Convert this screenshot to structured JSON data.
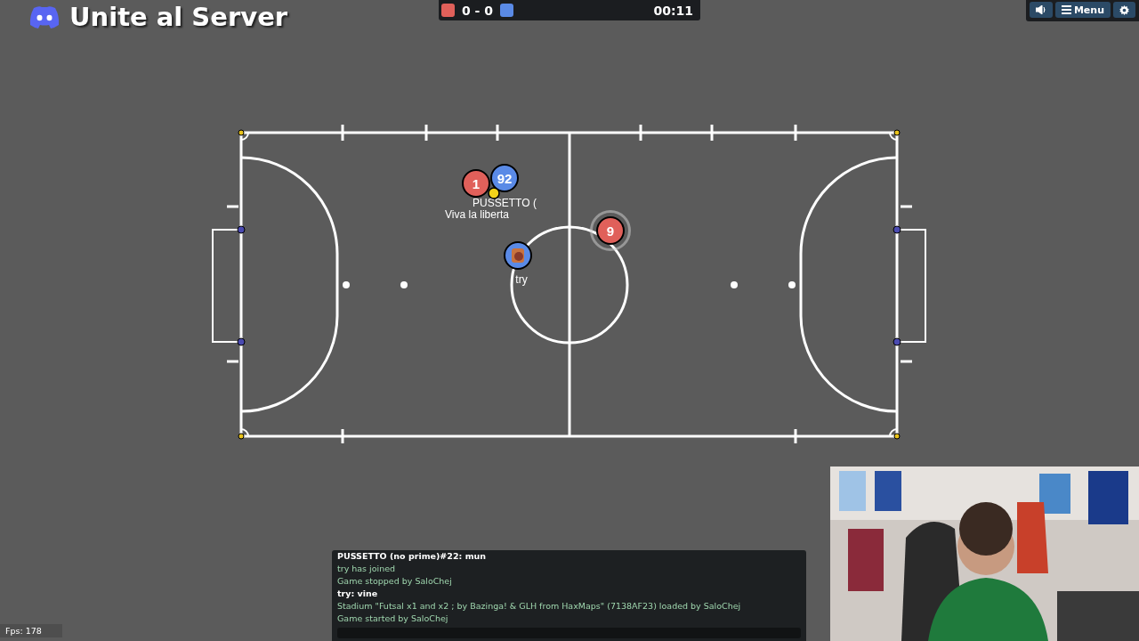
{
  "overlay_title": "Unite al Server",
  "scoreboard": {
    "teams": [
      {
        "color": "#e0605a"
      },
      {
        "color": "#5a8ae6"
      }
    ],
    "score": "0 - 0",
    "time": "00:11"
  },
  "toolbar": {
    "menu_label": "Menu"
  },
  "players": [
    {
      "kind": "number",
      "label": "1",
      "color": "#e0605a",
      "name": "Viva la liberta",
      "kicking": false
    },
    {
      "kind": "number",
      "label": "92",
      "color": "#5a8ae6",
      "name": "PUSSETTO (",
      "kicking": false
    },
    {
      "kind": "number",
      "label": "9",
      "color": "#e0605a",
      "kicking": true
    },
    {
      "kind": "avatar",
      "color": "#5a8ae6",
      "name": "try",
      "kicking": false
    }
  ],
  "chat": {
    "messages": [
      {
        "kind": "player",
        "text": "PUSSETTO (no prime)#22: mun"
      },
      {
        "kind": "notice",
        "text": "try has joined"
      },
      {
        "kind": "notice",
        "text": "Game stopped by SaloChej"
      },
      {
        "kind": "player",
        "text": "try: vine"
      },
      {
        "kind": "notice",
        "text": "Stadium \"Futsal x1 and x2 ; by Bazinga! & GLH from HaxMaps\" (7138AF23) loaded by SaloChej"
      },
      {
        "kind": "notice",
        "text": "Game started by SaloChej"
      }
    ]
  },
  "fps": "Fps: 178"
}
